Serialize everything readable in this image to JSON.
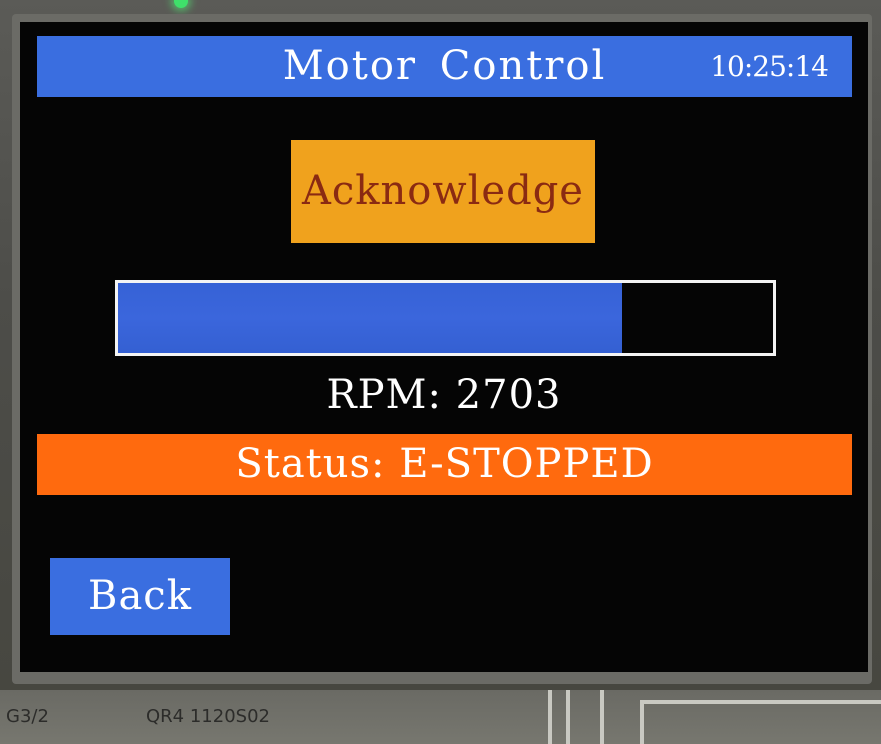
{
  "screen": {
    "title": "Motor Control",
    "clock": "10:25:14"
  },
  "controls": {
    "acknowledge_label": "Acknowledge",
    "back_label": "Back"
  },
  "rpm": {
    "readout": "RPM: 2703",
    "bar_fraction": 0.77
  },
  "status": {
    "text": "Status: E-STOPPED"
  },
  "board_silkscreen": {
    "left_label": "G3/2",
    "center_label": "QR4 1120S02"
  },
  "colors": {
    "title_bar": "#3a6ee0",
    "acknowledge_button": "#f0a21d",
    "acknowledge_text": "#8a2a12",
    "rpm_fill": "#3662d6",
    "status_bar": "#ff6a0e",
    "back_button": "#3a6ee0",
    "screen_background": "#050505"
  }
}
